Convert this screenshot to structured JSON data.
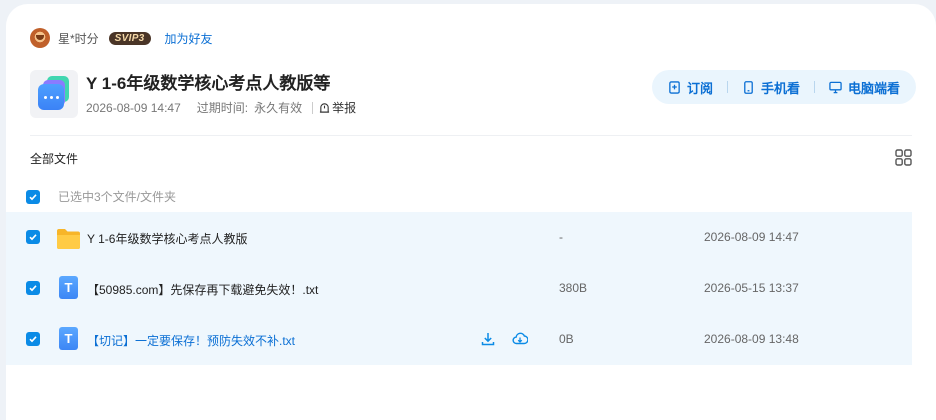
{
  "user": {
    "name": "星*时分",
    "vip_badge": "SVIP3",
    "add_friend": "加为好友"
  },
  "share": {
    "title": "Y 1-6年级数学核心考点人教版等",
    "date": "2026-08-09 14:47",
    "expire_label": "过期时间:",
    "expire_value": "永久有效",
    "report": "举报"
  },
  "actions": {
    "subscribe": "订阅",
    "mobile_view": "手机看",
    "pc_view": "电脑端看"
  },
  "list": {
    "all_files": "全部文件",
    "selection_text": "已选中3个文件/文件夹"
  },
  "files": [
    {
      "name": "Y 1-6年级数学核心考点人教版",
      "size": "-",
      "date": "2026-08-09 14:47",
      "type": "folder-icon",
      "checked": true
    },
    {
      "name": "【50985.com】先保存再下载避免失效！.txt",
      "size": "380B",
      "date": "2026-05-15 13:37",
      "type": "txt-file-icon",
      "checked": true
    },
    {
      "name": "【切记】一定要保存！预防失效不补.txt",
      "size": "0B",
      "date": "2026-08-09 13:48",
      "type": "txt-file-icon",
      "checked": true
    }
  ],
  "colors": {
    "accent": "#0b6fd4",
    "checkbox": "#0b8be6",
    "row_bg": "#eff7fd",
    "action_bg": "#eaf5fd"
  }
}
